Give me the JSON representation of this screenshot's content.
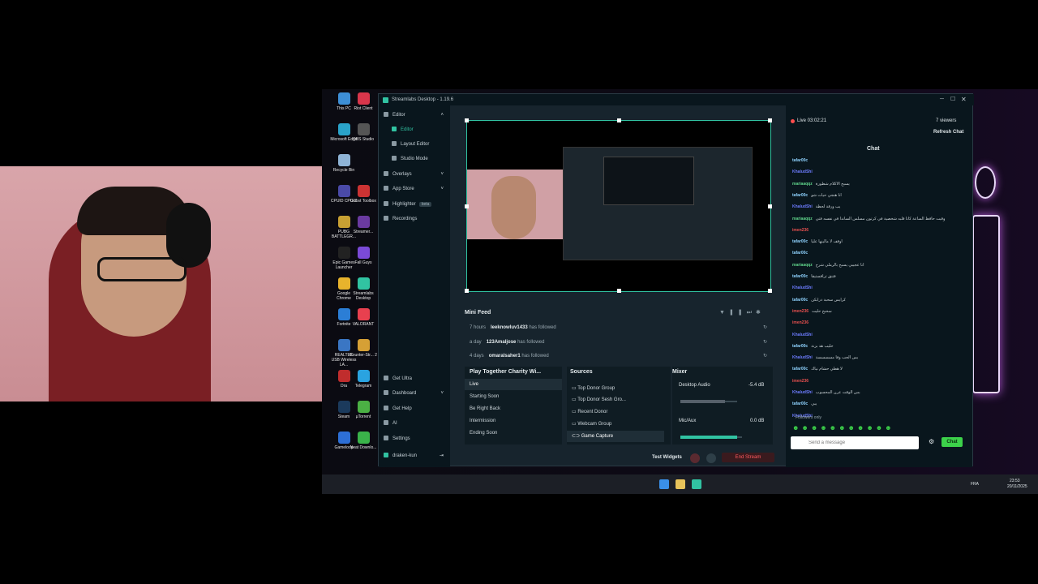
{
  "window": {
    "title": "Streamlabs Desktop - 1.19.6"
  },
  "desktop_icons": [
    {
      "label": "This PC",
      "color": "#3d8fd6"
    },
    {
      "label": "Riot Client",
      "color": "#d9364b"
    },
    {
      "label": "Microsoft Edge",
      "color": "#2aa3c9"
    },
    {
      "label": "OBS Studio",
      "color": "#555555"
    },
    {
      "label": "Recycle Bin",
      "color": "#8fb4d6"
    },
    {
      "label": "CPUID CPU-Z",
      "color": "#4a4aa8"
    },
    {
      "label": "Ghost Toolbox",
      "color": "#cc3333"
    },
    {
      "label": "PUBG BATTLEGR...",
      "color": "#c8a033"
    },
    {
      "label": "Streamer...",
      "color": "#6a3aa0"
    },
    {
      "label": "Epic Games Launcher",
      "color": "#222222"
    },
    {
      "label": "Fall Guys",
      "color": "#7b4ad8"
    },
    {
      "label": "Google Chrome",
      "color": "#e8b32c"
    },
    {
      "label": "Streamlabs Desktop",
      "color": "#31c3a2"
    },
    {
      "label": "Fortnite",
      "color": "#2b7ed6"
    },
    {
      "label": "VALORANT",
      "color": "#e8404f"
    },
    {
      "label": "REALTEK USB Wireless LA...",
      "color": "#3a76c4"
    },
    {
      "label": "Counter-Str... 2",
      "color": "#d6a035"
    },
    {
      "label": "Dra",
      "color": "#c02d2d"
    },
    {
      "label": "Telegram",
      "color": "#2aa3e0"
    },
    {
      "label": "Steam",
      "color": "#1b3a5c"
    },
    {
      "label": "µTorrent",
      "color": "#4bb044"
    },
    {
      "label": "Gameloop",
      "color": "#2d6fd6"
    },
    {
      "label": "Neat Downlo...",
      "color": "#3ab34a"
    }
  ],
  "sidebar": {
    "editor": "Editor",
    "items": [
      {
        "label": "Editor",
        "active": true
      },
      {
        "label": "Layout Editor"
      },
      {
        "label": "Studio Mode"
      },
      {
        "label": "Overlays"
      },
      {
        "label": "App Store"
      },
      {
        "label": "Highlighter",
        "badge": "beta"
      },
      {
        "label": "Recordings"
      }
    ],
    "bottom": [
      "Get Ultra",
      "Dashboard",
      "Get Help",
      "AI",
      "Settings"
    ],
    "user": "draken-kun"
  },
  "mini_feed": {
    "title": "Mini Feed",
    "rows": [
      {
        "time": "7 hours",
        "user": "leeknowluv1433",
        "action": "has followed"
      },
      {
        "time": "a day",
        "user": "123Amaljose",
        "action": "has followed"
      },
      {
        "time": "4 days",
        "user": "omaralsaher1",
        "action": "has followed"
      }
    ]
  },
  "scenes": {
    "title": "Play Together Charity Wi...",
    "items": [
      "Live",
      "Starting Soon",
      "Be Right Back",
      "Intermission",
      "Ending Soon"
    ]
  },
  "sources": {
    "title": "Sources",
    "items": [
      "Top Donor Group",
      "Top Donor Sesh Gro...",
      "Recent Donor",
      "Webcam Group",
      "Game Capture"
    ]
  },
  "mixer": {
    "title": "Mixer",
    "channels": [
      {
        "name": "Desktop Audio",
        "db": "-5.4 dB",
        "level": 0.78
      },
      {
        "name": "Mic/Aux",
        "db": "0.0 dB",
        "level": 0.92
      }
    ]
  },
  "bottom_bar": {
    "test_widgets": "Test Widgets",
    "end_stream": "End Stream"
  },
  "chat": {
    "live": "Live 03:02:21",
    "viewers": "7 viewers",
    "refresh": "Refresh Chat",
    "title": "Chat",
    "messages": [
      {
        "user": "tafar00c",
        "text": "",
        "color": "#8fd3ff"
      },
      {
        "user": "KhaludShi",
        "text": "",
        "color": "#6d7cff"
      },
      {
        "user": "mariaaqqz",
        "text": "يسبح الاكلام شطورة",
        "color": "#5fd38a"
      },
      {
        "user": "tafar00c",
        "text": "انا هنجي حيات شو",
        "color": "#8fd3ff"
      },
      {
        "user": "KhaludShi",
        "text": "يب ورقة لحظة",
        "color": "#6d7cff"
      },
      {
        "user": "mariaaqqz",
        "text": "وقيت حافظ الساعة كانا قلبه شخصية في كرتون مسلس الساندا في نفسه فتي",
        "color": "#5fd38a"
      },
      {
        "user": "imen236",
        "text": "",
        "color": "#e8504f"
      },
      {
        "user": "tafar00c",
        "text": "اوقف لا مالينها عليا",
        "color": "#8fd3ff"
      },
      {
        "user": "tafar00c",
        "text": "",
        "color": "#8fd3ff"
      },
      {
        "user": "mariaaqqz",
        "text": "انا عجيبي يسبح بالرملي شرح",
        "color": "#5fd38a"
      },
      {
        "user": "tafar00c",
        "text": "فتنق ترافستيقا",
        "color": "#8fd3ff"
      },
      {
        "user": "KhaludShi",
        "text": "",
        "color": "#6d7cff"
      },
      {
        "user": "tafar00c",
        "text": "كرايس سحبة درابكن",
        "color": "#8fd3ff"
      },
      {
        "user": "imen236",
        "text": "سحبح حليت",
        "color": "#e8504f"
      },
      {
        "user": "imen236",
        "text": "",
        "color": "#e8504f"
      },
      {
        "user": "KhaludShi",
        "text": "",
        "color": "#6d7cff"
      },
      {
        "user": "tafar00c",
        "text": "حليب هذ بزنة",
        "color": "#8fd3ff"
      },
      {
        "user": "KhaludShi",
        "text": "بس الحب وفا مسسسسة",
        "color": "#6d7cff"
      },
      {
        "user": "tafar00c",
        "text": "لا هطي حشام نياك",
        "color": "#8fd3ff"
      },
      {
        "user": "imen236",
        "text": "",
        "color": "#e8504f"
      },
      {
        "user": "KhaludShi",
        "text": "بس الوقت عرن المحسوب",
        "color": "#6d7cff"
      },
      {
        "user": "tafar00c",
        "text": "يبي",
        "color": "#8fd3ff"
      },
      {
        "user": "KhaludShi",
        "text": "",
        "color": "#6d7cff"
      }
    ],
    "followers_only": "Followers only",
    "placeholder": "Send a message",
    "send": "Chat"
  },
  "taskbar": {
    "lang": "FRA",
    "time": "23:53",
    "date": "20/11/2025"
  }
}
